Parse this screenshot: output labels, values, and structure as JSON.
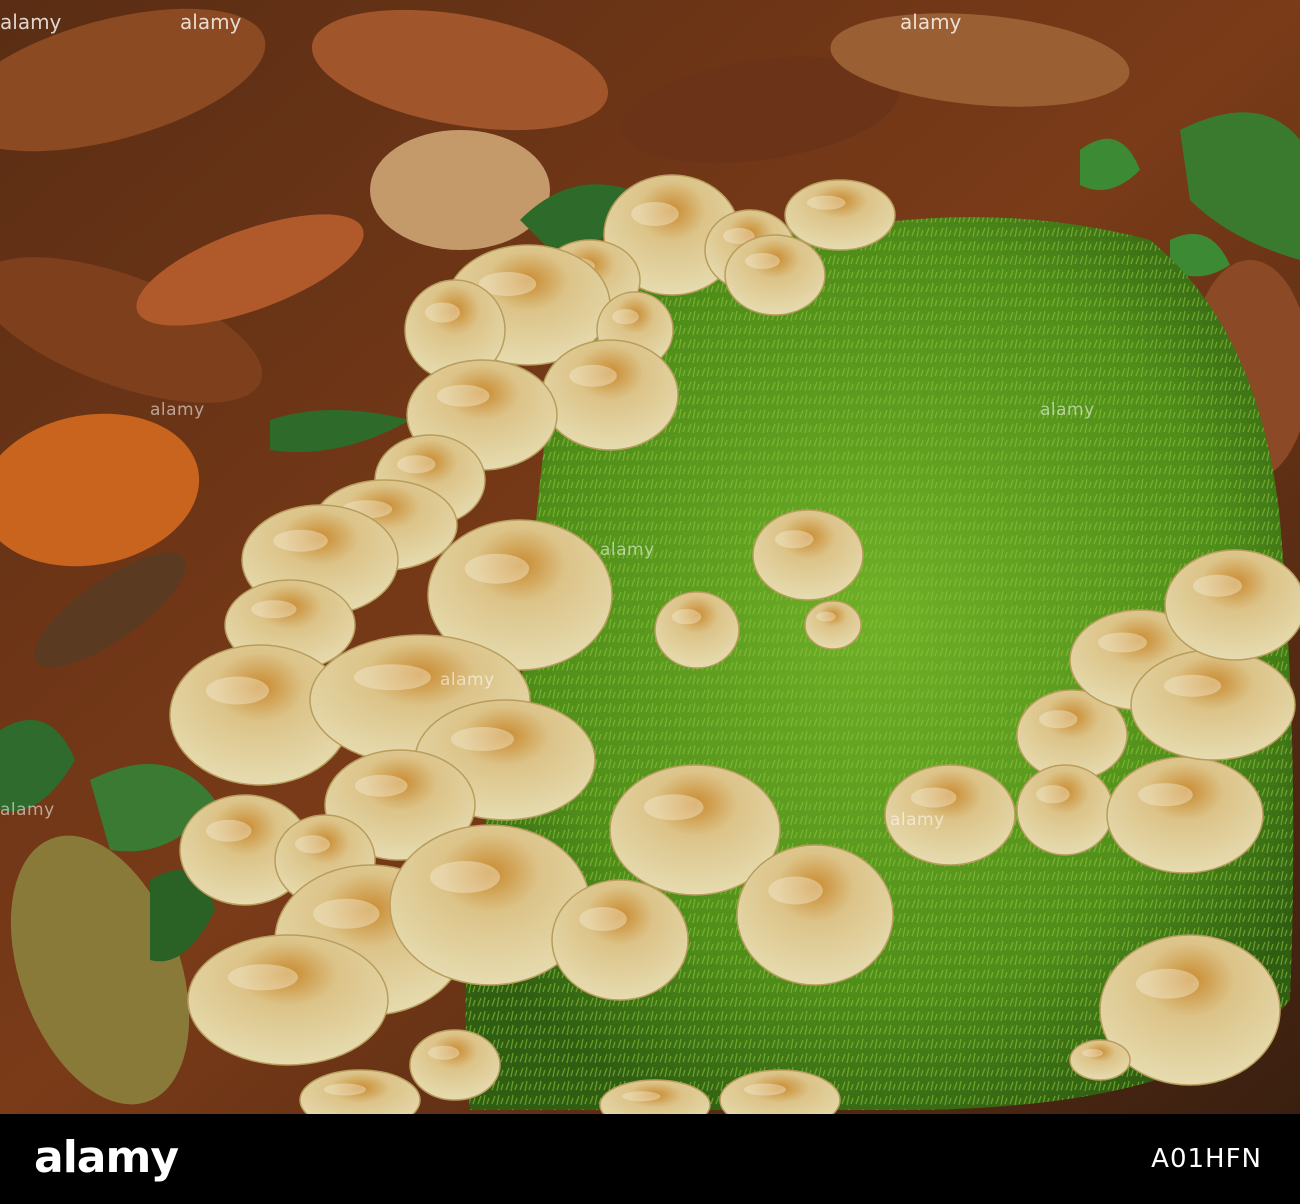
{
  "image": {
    "subject": "mushrooms",
    "colors": {
      "moss": "#5b9a1e",
      "cap": "#d8cc95",
      "cap_center": "#c98a2e",
      "leaf_litter": "#7a3a18",
      "ivy": "#2e6b2a"
    }
  },
  "watermark": {
    "text": "alamy",
    "repeat": "alamy"
  },
  "footer": {
    "logo": "alamy",
    "image_id": "A01HFN"
  }
}
